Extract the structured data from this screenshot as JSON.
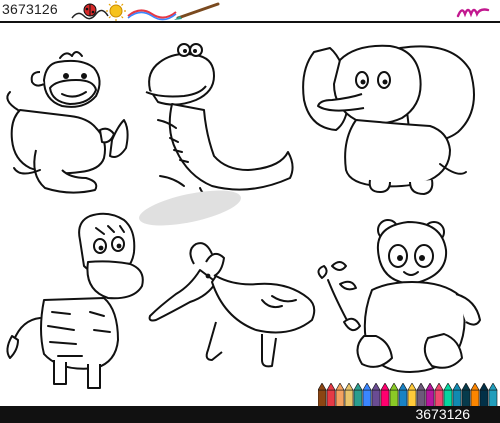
{
  "header": {
    "id_text": "3673126",
    "rule_color": "#111111"
  },
  "footer": {
    "id_text": "3673126",
    "background": "#111111"
  },
  "page": {
    "background": "#ffffff",
    "ink_color": "#111111"
  },
  "illustrations": [
    {
      "name": "monkey",
      "icon": "monkey-with-banana-icon"
    },
    {
      "name": "crocodile",
      "icon": "crocodile-icon"
    },
    {
      "name": "elephant",
      "icon": "elephant-icon"
    },
    {
      "name": "zebra",
      "icon": "zebra-icon"
    },
    {
      "name": "anteater",
      "icon": "anteater-icon"
    },
    {
      "name": "panda",
      "icon": "panda-with-branch-icon"
    }
  ],
  "decorations": {
    "ladybug_color": "#d62828",
    "sun_color": "#f6c21b",
    "brush_color": "#7a4a1f",
    "logo_color": "#c2188f",
    "pencil_colors": [
      "#8b4513",
      "#e63946",
      "#f4a261",
      "#e9c46a",
      "#2a9d8f",
      "#3a86ff",
      "#6a4c93",
      "#ff006e",
      "#8ac926",
      "#1982c4",
      "#ffca3a",
      "#6d597a",
      "#b5179e",
      "#ef476f",
      "#06d6a0",
      "#118ab2",
      "#073b4c",
      "#fb8500",
      "#023047",
      "#219ebc"
    ]
  }
}
